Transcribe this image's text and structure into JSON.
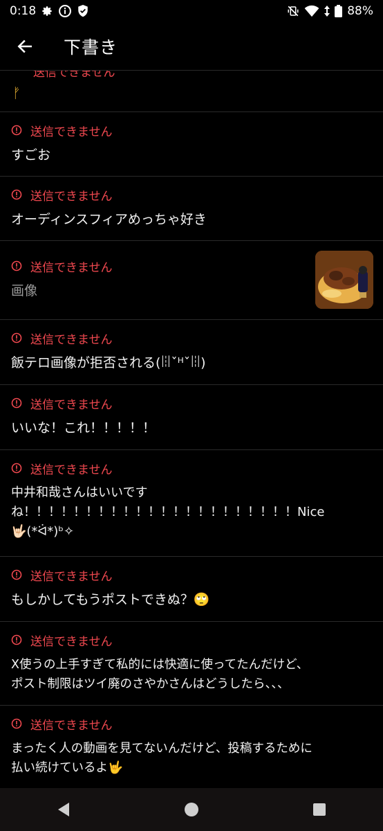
{
  "status_bar": {
    "time": "0:18",
    "battery": "88%"
  },
  "app_bar": {
    "title": "下書き"
  },
  "drafts": {
    "error_label": "送信できません",
    "first_glyph": "ᚠ",
    "items": [
      {
        "text": "すごお"
      },
      {
        "text": "オーディンスフィアめっちゃ好き"
      },
      {
        "text": "画像",
        "has_image": true
      },
      {
        "text": "飯テロ画像が拒否される(ꈨˇᴴˇꈨ)"
      },
      {
        "text": "いいな！これ！！！！！"
      },
      {
        "text": "中井和哉さんはいいです\nね！！！！！！！！！！！！！！！！！！！！！！Nice\n🤟🏻(*ᐛ*)ᵇ✧"
      },
      {
        "text": "もしかしてもうポストできぬ？🙄"
      },
      {
        "text": "X使うの上手すぎて私的には快適に使ってたんだけど、\nポスト制限はツイ廃のさやかさんはどうしたら、、、"
      },
      {
        "text": "まったく人の動画を見てないんだけど、投稿するために\n払い続けているよ🤟"
      }
    ]
  },
  "colors": {
    "background": "#000000",
    "error": "#f0484f",
    "divider": "#2a2a2a"
  }
}
